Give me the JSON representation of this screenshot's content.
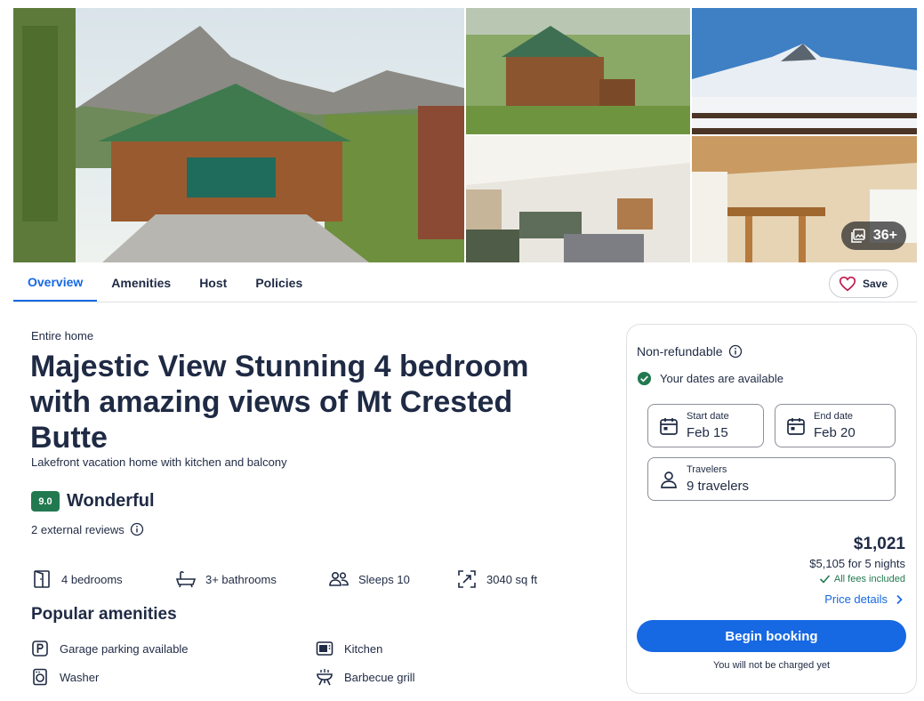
{
  "gallery": {
    "more_photos_label": "36+"
  },
  "tabs": [
    {
      "label": "Overview",
      "active": true
    },
    {
      "label": "Amenities",
      "active": false
    },
    {
      "label": "Host",
      "active": false
    },
    {
      "label": "Policies",
      "active": false
    }
  ],
  "save_label": "Save",
  "property": {
    "type": "Entire home",
    "title": "Majestic View Stunning 4 bedroom with amazing views of Mt Crested Butte",
    "subtitle": "Lakefront vacation home with kitchen and balcony",
    "rating": "9.0",
    "rating_word": "Wonderful",
    "reviews": "2 external reviews"
  },
  "facts": [
    {
      "icon": "bedroom-icon",
      "label": "4 bedrooms"
    },
    {
      "icon": "bathtub-icon",
      "label": "3+ bathrooms"
    },
    {
      "icon": "people-icon",
      "label": "Sleeps 10"
    },
    {
      "icon": "area-icon",
      "label": "3040 sq ft"
    }
  ],
  "amenities": {
    "title": "Popular amenities",
    "items": [
      {
        "icon": "parking-icon",
        "label": "Garage parking available"
      },
      {
        "icon": "kitchen-icon",
        "label": "Kitchen"
      },
      {
        "icon": "washer-icon",
        "label": "Washer"
      },
      {
        "icon": "grill-icon",
        "label": "Barbecue grill"
      }
    ]
  },
  "booking": {
    "refund_policy": "Non-refundable",
    "availability": "Your dates are available",
    "start_label": "Start date",
    "start_value": "Feb 15",
    "end_label": "End date",
    "end_value": "Feb 20",
    "travelers_label": "Travelers",
    "travelers_value": "9 travelers",
    "price_per_night": "$1,021",
    "price_total": "$5,105 for 5 nights",
    "fees_note": "All fees included",
    "price_details": "Price details",
    "book_button": "Begin booking",
    "charge_note": "You will not be charged yet"
  },
  "colors": {
    "accent": "#1668e3",
    "rating_green": "#227950",
    "text": "#1f2a44"
  }
}
